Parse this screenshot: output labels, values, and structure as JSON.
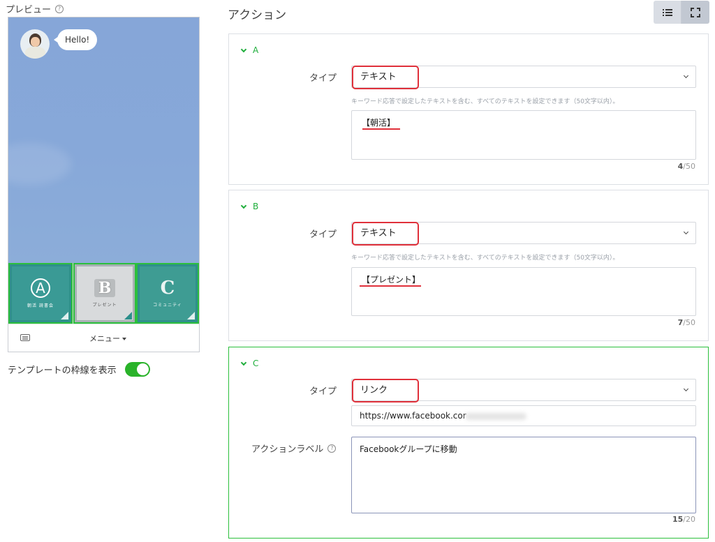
{
  "preview": {
    "title": "プレビュー",
    "bubble_text": "Hello!",
    "tiles": [
      {
        "letter": "A",
        "caption": "朝活 読書会"
      },
      {
        "letter": "B",
        "caption": "プレゼント"
      },
      {
        "letter": "C",
        "caption": "コミュニティ"
      }
    ],
    "menu_label": "メニュー",
    "border_toggle_label": "テンプレートの枠線を表示",
    "border_toggle_on": true
  },
  "actions": {
    "title": "アクション",
    "items": [
      {
        "name": "A",
        "type_label": "タイプ",
        "type_value": "テキスト",
        "help": "キーワード応答で設定したテキストを含む、すべてのテキストを設定できます（50文字以内）。",
        "text": "【朝活】",
        "count": "4",
        "max": "/50"
      },
      {
        "name": "B",
        "type_label": "タイプ",
        "type_value": "テキスト",
        "help": "キーワード応答で設定したテキストを含む、すべてのテキストを設定できます（50文字以内）。",
        "text": "【プレゼント】",
        "count": "7",
        "max": "/50"
      },
      {
        "name": "C",
        "type_label": "タイプ",
        "type_value": "リンク",
        "url": "https://www.facebook.cor",
        "label_label": "アクションラベル",
        "label_value": "Facebookグループに移動",
        "count": "15",
        "max": "/20"
      }
    ]
  },
  "colors": {
    "accent_green": "#2bbf3c",
    "highlight_red": "#e0303a",
    "chat_bg": "#87a8d9"
  }
}
